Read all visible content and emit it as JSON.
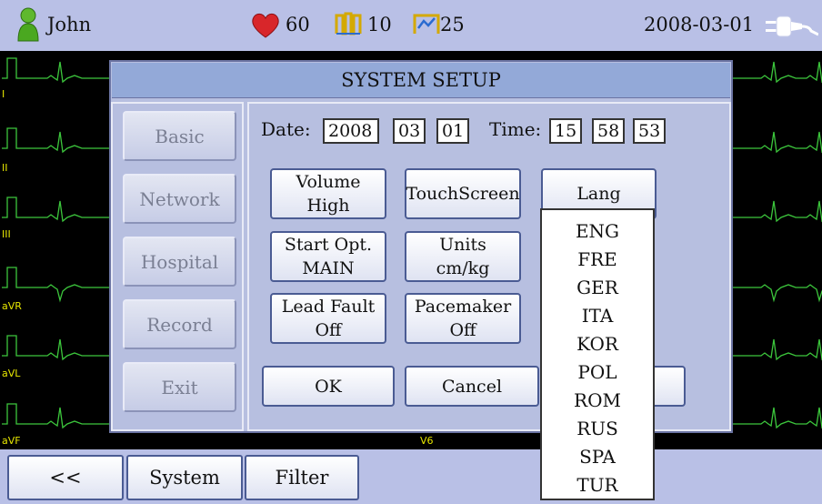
{
  "topbar": {
    "user_icon": "person-icon",
    "user_name": "John",
    "heart_icon": "heart-icon",
    "heart_rate": "60",
    "lead_icon_1": "lead-waveform-icon",
    "value_2": "10",
    "lead_icon_2": "lead-waveform-icon",
    "value_3": "25",
    "date": "2008-03-01",
    "battery_icon": "power-plug-icon"
  },
  "ecg": {
    "leads": [
      "I",
      "II",
      "III",
      "aVR",
      "aVL",
      "aVF"
    ],
    "bottom_label": "V6",
    "trace_color": "#3cc63c"
  },
  "dialog": {
    "title": "SYSTEM SETUP",
    "menu": [
      "Basic",
      "Network",
      "Hospital",
      "Record",
      "Exit"
    ],
    "date_label": "Date:",
    "date_year": "2008",
    "date_month": "03",
    "date_day": "01",
    "time_label": "Time:",
    "time_hour": "15",
    "time_min": "58",
    "time_sec": "53",
    "volume": {
      "line1": "Volume",
      "line2": "High"
    },
    "touchscreen": "TouchScreen",
    "lang": "Lang",
    "start_opt": {
      "line1": "Start Opt.",
      "line2": "MAIN"
    },
    "units": {
      "line1": "Units",
      "line2": "cm/kg"
    },
    "lead_fault": {
      "line1": "Lead Fault",
      "line2": "Off"
    },
    "pacemaker": {
      "line1": "Pacemaker",
      "line2": "Off"
    },
    "ok": "OK",
    "cancel": "Cancel",
    "languages": [
      "ENG",
      "FRE",
      "GER",
      "ITA",
      "KOR",
      "POL",
      "ROM",
      "RUS",
      "SPA",
      "TUR"
    ]
  },
  "bottombar": {
    "back": "<<",
    "system": "System",
    "filter": "Filter"
  }
}
